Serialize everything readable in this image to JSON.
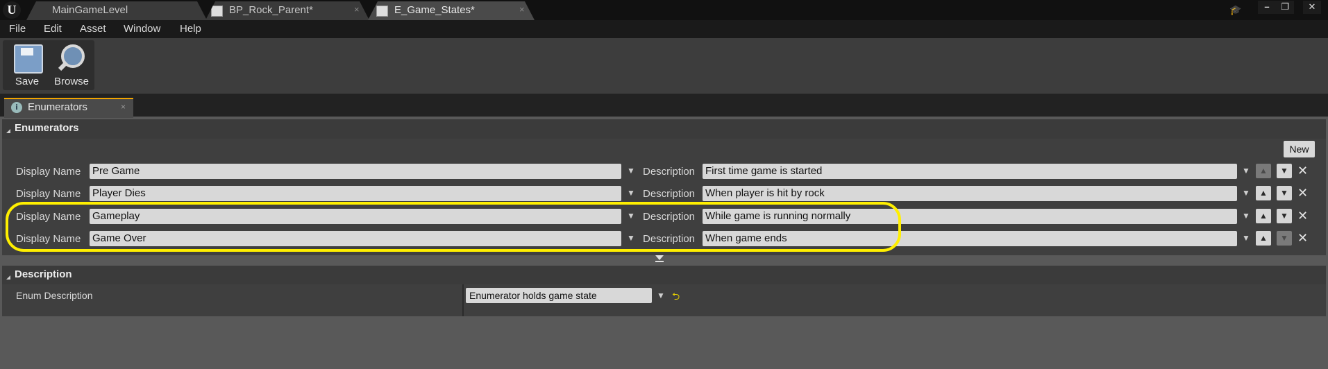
{
  "window": {
    "tabs": [
      {
        "label": "MainGameLevel",
        "active": false
      },
      {
        "label": "BP_Rock_Parent*",
        "active": false
      },
      {
        "label": "E_Game_States*",
        "active": true
      }
    ],
    "close_glyph": "×",
    "controls": {
      "minimize": "–",
      "restore": "❐",
      "close": "✕"
    }
  },
  "menu": [
    "File",
    "Edit",
    "Asset",
    "Window",
    "Help"
  ],
  "toolbar": {
    "save_label": "Save",
    "browse_label": "Browse"
  },
  "panel_tab": {
    "label": "Enumerators",
    "close": "×"
  },
  "enumerators_section": {
    "title": "Enumerators",
    "new_button": "New",
    "display_name_label": "Display Name",
    "description_label": "Description",
    "rows": [
      {
        "display_name": "Pre Game",
        "description": "First time game is started",
        "up_enabled": false,
        "down_enabled": true
      },
      {
        "display_name": "Player Dies",
        "description": "When player is hit by rock",
        "up_enabled": true,
        "down_enabled": true
      },
      {
        "display_name": "Gameplay",
        "description": "While game is running normally",
        "up_enabled": true,
        "down_enabled": true
      },
      {
        "display_name": "Game Over",
        "description": "When game ends",
        "up_enabled": true,
        "down_enabled": false
      }
    ]
  },
  "description_section": {
    "title": "Description",
    "field_label": "Enum Description",
    "field_value": "Enumerator holds game state"
  },
  "colors": {
    "highlight": "#ffef00",
    "accent_tab": "#f0a400",
    "background": "#595959"
  }
}
